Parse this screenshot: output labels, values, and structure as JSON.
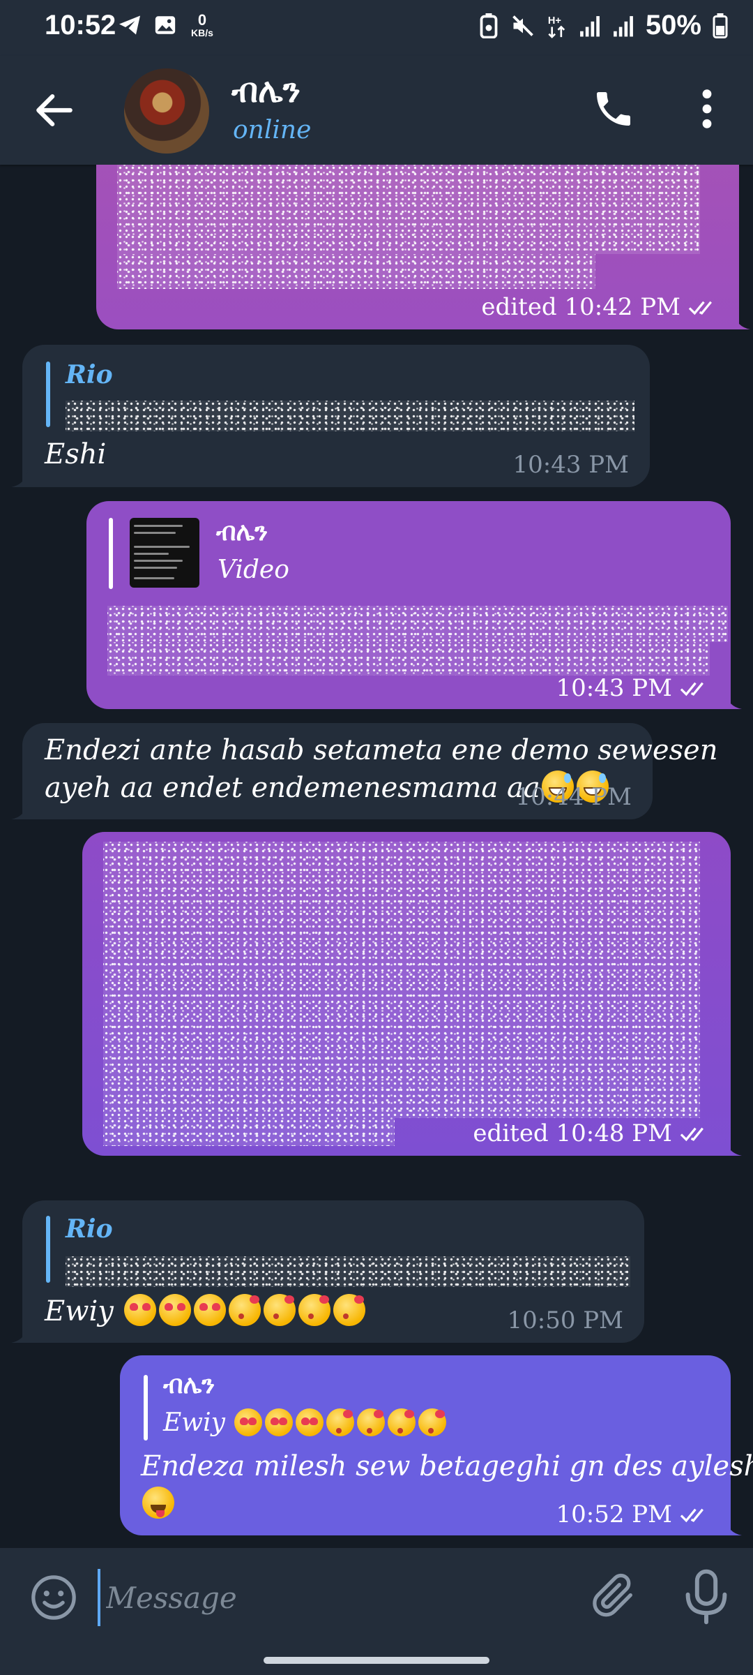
{
  "status_bar": {
    "time": "10:52",
    "net_speed_value": "0",
    "net_speed_unit": "KB/s",
    "battery_percent": "50%"
  },
  "header": {
    "name": "ብሌን",
    "status": "online"
  },
  "messages": [
    {
      "meta": "edited 10:42 PM"
    },
    {
      "reply_name": "Rio",
      "text": "Eshi",
      "meta": "10:43 PM"
    },
    {
      "reply_name": "ብሌን",
      "reply_text": "Video",
      "meta": "10:43 PM"
    },
    {
      "text_line1": "Endezi ante hasab setameta ene demo sewesen",
      "text_line2": "ayeh aa endet endemenesmama aa",
      "meta": "10:44 PM"
    },
    {
      "meta": "edited 10:48 PM"
    },
    {
      "reply_name": "Rio",
      "text": "Ewiy",
      "meta": "10:50 PM"
    },
    {
      "reply_name": "ብሌን",
      "reply_text": "Ewiy",
      "text": "Endeza milesh sew betageghi gn des ayleshim",
      "meta": "10:52 PM"
    }
  ],
  "composer": {
    "placeholder": "Message"
  },
  "colors": {
    "header_bg": "#232d3a",
    "chat_bg": "#141b24",
    "incoming_bubble": "#232d3a",
    "outgoing_bubble_1": "#9b4fc0",
    "outgoing_bubble_2": "#8f4ec6",
    "outgoing_bubble_3": "#7e4fd2",
    "outgoing_bubble_4": "#6a5fe0",
    "accent_blue": "#64b5f6"
  },
  "icons": {
    "back": "arrow-left-icon",
    "call": "phone-icon",
    "menu": "more-vertical-icon",
    "emoji": "emoji-icon",
    "attach": "paperclip-icon",
    "mic": "microphone-icon",
    "read": "double-check-icon"
  }
}
